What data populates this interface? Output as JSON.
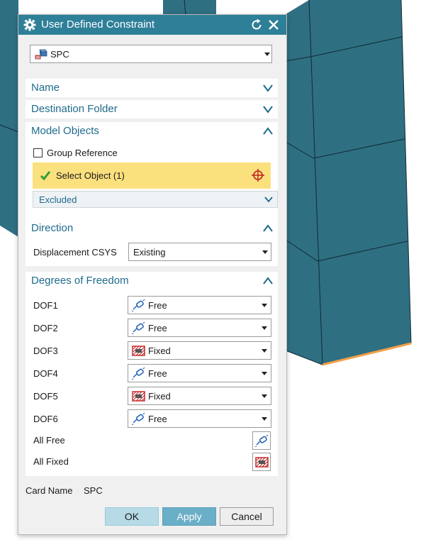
{
  "dialog": {
    "title": "User Defined Constraint",
    "type_selector": {
      "icon": "spc-constraint-icon",
      "value": "SPC"
    },
    "groups": {
      "name": {
        "label": "Name",
        "expanded": false
      },
      "destination_folder": {
        "label": "Destination Folder",
        "expanded": false
      },
      "model_objects": {
        "label": "Model Objects",
        "expanded": true,
        "group_reference": {
          "label": "Group Reference",
          "checked": false
        },
        "select_object": {
          "label": "Select Object (1)"
        },
        "excluded": {
          "label": "Excluded"
        }
      },
      "direction": {
        "label": "Direction",
        "expanded": true,
        "displacement_csys": {
          "label": "Displacement CSYS",
          "value": "Existing"
        }
      },
      "dof": {
        "label": "Degrees of Freedom",
        "expanded": true,
        "rows": [
          {
            "label": "DOF1",
            "value": "Free",
            "icon": "free-dof-icon"
          },
          {
            "label": "DOF2",
            "value": "Free",
            "icon": "free-dof-icon"
          },
          {
            "label": "DOF3",
            "value": "Fixed",
            "icon": "fixed-dof-icon"
          },
          {
            "label": "DOF4",
            "value": "Free",
            "icon": "free-dof-icon"
          },
          {
            "label": "DOF5",
            "value": "Fixed",
            "icon": "fixed-dof-icon"
          },
          {
            "label": "DOF6",
            "value": "Free",
            "icon": "free-dof-icon"
          }
        ],
        "all_free": {
          "label": "All Free"
        },
        "all_fixed": {
          "label": "All Fixed"
        }
      }
    },
    "card_name": {
      "label": "Card Name",
      "value": "SPC"
    },
    "buttons": {
      "ok": "OK",
      "apply": "Apply",
      "cancel": "Cancel"
    }
  },
  "colors": {
    "title_bar": "#2e7f98",
    "group_header_text": "#1e6b8c",
    "selection_highlight": "#fbe07e",
    "mesh_face": "#2f6f82",
    "mesh_edge_highlight": "#f2a04a"
  }
}
